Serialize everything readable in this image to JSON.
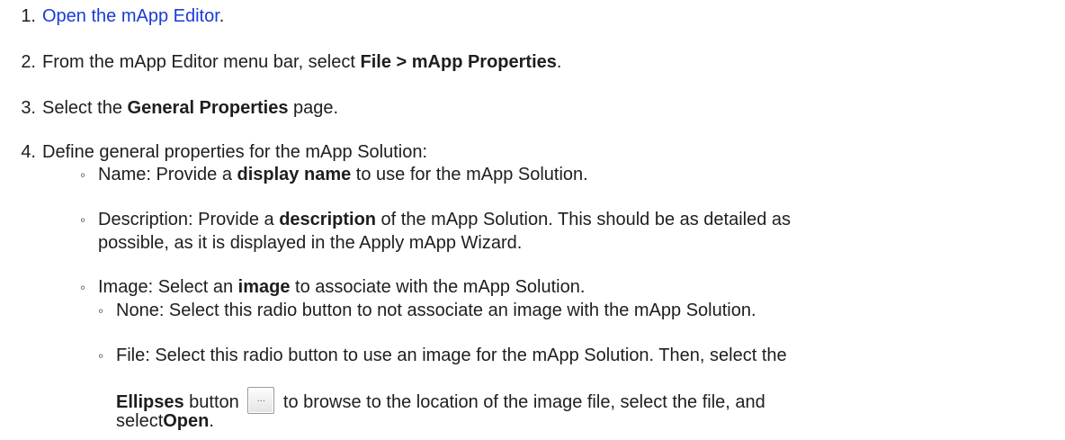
{
  "steps": [
    {
      "num": "1.",
      "link": "Open the mApp Editor",
      "after": "."
    },
    {
      "num": "2.",
      "pre": "From the mApp Editor menu bar, select ",
      "bold": "File > mApp Properties",
      "post": "."
    },
    {
      "num": "3.",
      "pre": "Select the ",
      "bold": "General Properties",
      "post": " page."
    },
    {
      "num": "4.",
      "text": "Define general properties for the mApp Solution:"
    }
  ],
  "sub_items": {
    "name": {
      "bullet": "◦",
      "pre": "Name: Provide a ",
      "bold": "display name",
      "post": " to use for the mApp Solution."
    },
    "description": {
      "bullet": "◦",
      "pre": "Description: Provide a ",
      "bold": "description",
      "post": " of the mApp Solution. This should be as detailed as",
      "line2": "possible, as it is displayed in the Apply mApp Wizard."
    },
    "image": {
      "bullet": "◦",
      "pre": "Image: Select an ",
      "bold": "image",
      "post": " to associate with the mApp Solution."
    },
    "none": {
      "bullet": "◦",
      "text": "None: Select this radio button to not associate an image with the mApp Solution."
    },
    "file": {
      "bullet": "◦",
      "line1": "File: Select this radio button to use an image for the mApp Solution. Then, select the",
      "bold1": "Ellipses",
      "mid": " button",
      "button_glyph": "...",
      "post": " to browse to the location of the image file, select the file, and",
      "line3_pre": "select",
      "bold2": "Open",
      "line3_post": "."
    }
  }
}
